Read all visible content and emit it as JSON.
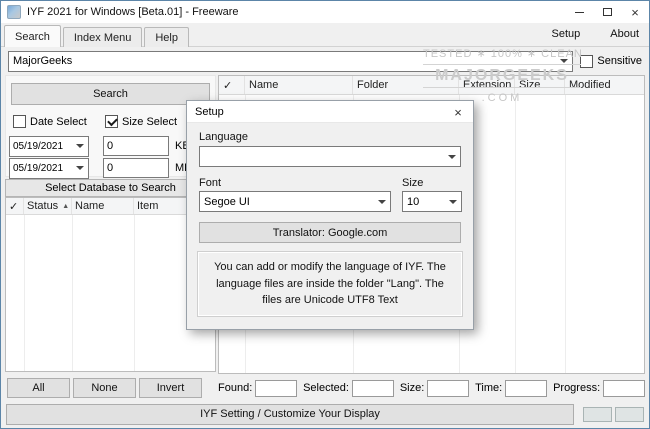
{
  "window": {
    "title": "IYF 2021 for Windows [Beta.01] - Freeware",
    "close_glyph": "×"
  },
  "tabs": {
    "search": "Search",
    "index_menu": "Index Menu",
    "help": "Help",
    "setup": "Setup",
    "about": "About"
  },
  "search": {
    "query": "MajorGeeks",
    "sensitive_label": "Sensitive"
  },
  "left_panel": {
    "search_button": "Search",
    "date_select_label": "Date Select",
    "size_select_label": "Size Select",
    "date_from": "05/19/2021",
    "date_to": "05/19/2021",
    "size_kb_value": "0",
    "size_kb_label": "KB",
    "size_mb_value": "0",
    "size_mb_label": "MB",
    "database_header": "Select Database to Search",
    "columns": {
      "check": "✓",
      "status": "Status",
      "sort_asc": "▲",
      "name": "Name",
      "item": "Item"
    },
    "all_button": "All",
    "none_button": "None",
    "invert_button": "Invert"
  },
  "results": {
    "columns": {
      "check": "✓",
      "name": "Name",
      "folder": "Folder",
      "extension": "Extension",
      "size": "Size",
      "modified": "Modified"
    },
    "status": {
      "found_label": "Found:",
      "selected_label": "Selected:",
      "size_label": "Size:",
      "time_label": "Time:",
      "progress_label": "Progress:"
    }
  },
  "watermark": {
    "arc": "TESTED ∗ 100% ∗ CLEAN",
    "name": "MAJORGEEKS",
    "tail": ".COM"
  },
  "setup_dialog": {
    "title": "Setup",
    "close_glyph": "×",
    "language_label": "Language",
    "language_value": "",
    "font_label": "Font",
    "font_value": "Segoe UI",
    "size_label": "Size",
    "size_value": "10",
    "translator_button": "Translator: Google.com",
    "info_text": "You can add or modify the language of IYF. The language files are inside the folder \"Lang\". The files are Unicode UTF8 Text"
  },
  "bottom_bar": {
    "settings_button": "IYF Setting / Customize Your Display"
  }
}
